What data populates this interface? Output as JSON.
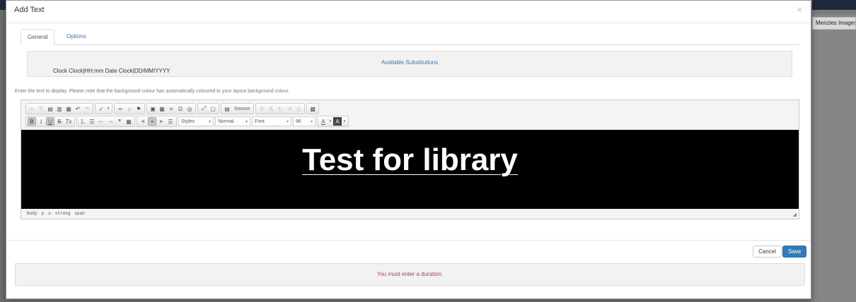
{
  "modal": {
    "title": "Add Text",
    "close": "×"
  },
  "backdrop": {
    "button_label": "Menzies Images"
  },
  "tabs": [
    {
      "label": "General"
    },
    {
      "label": "Options"
    }
  ],
  "substitutions": {
    "link": "Available Substitutions",
    "text": "Clock Clock|HH:mm Date Clock|DD/MM/YYYY"
  },
  "help_text": "Enter the text to display. Please note that the background colour has automatically coloured to your layout background colour.",
  "toolbar": {
    "source_label": "Source",
    "styles_combo": "Styles",
    "format_combo": "Normal",
    "font_combo": "Font",
    "size_combo": "96"
  },
  "editor": {
    "content": "Test for library",
    "path": [
      "body",
      "p",
      "u",
      "strong",
      "span"
    ],
    "background": "#000000",
    "text_color": "#ffffff"
  },
  "footer": {
    "cancel_label": "Cancel",
    "save_label": "Save"
  },
  "alert": {
    "message": "You must enter a duration."
  },
  "colors": {
    "accent": "#337ab7",
    "error": "#a94442"
  }
}
